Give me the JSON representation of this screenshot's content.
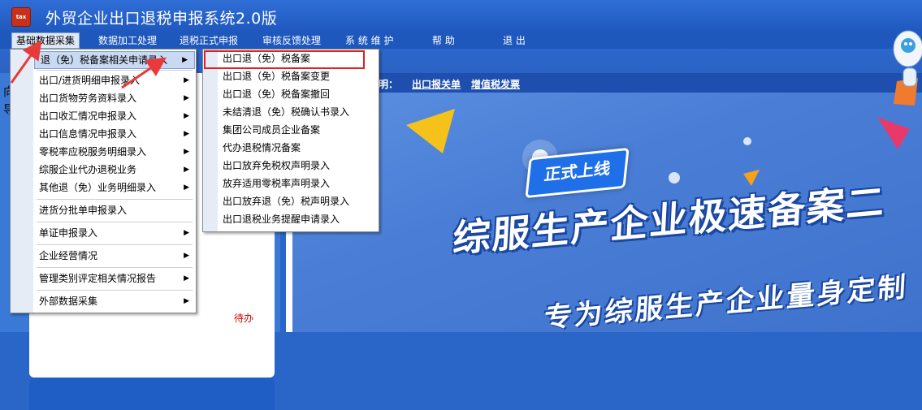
{
  "app": {
    "title": "外贸企业出口退税申报系统2.0版",
    "icon_text": "tax"
  },
  "menubar": [
    {
      "label": "基础数据采集"
    },
    {
      "label": "数据加工处理"
    },
    {
      "label": "退税正式申报"
    },
    {
      "label": "审核反馈处理"
    },
    {
      "label": "系 统 维 护"
    },
    {
      "label": "帮 助"
    },
    {
      "label": "退 出"
    }
  ],
  "left_panel": {
    "todo_label": "待办",
    "side_chars": [
      "向",
      "导"
    ]
  },
  "main": {
    "info_prefix": "说明：",
    "info_links": [
      "出口报关单",
      "增值税发票"
    ],
    "badge": "正式上线",
    "headline": "综服生产企业极速备案二",
    "subline": "专为综服生产企业量身定制"
  },
  "menu1": {
    "items": [
      {
        "label": "退（免）税备案相关申请录入",
        "submenu": true
      },
      {
        "label": "出口/进货明细申报录入",
        "submenu": true
      },
      {
        "label": "出口货物劳务资料录入",
        "submenu": true
      },
      {
        "label": "出口收汇情况申报录入",
        "submenu": true
      },
      {
        "label": "出口信息情况申报录入",
        "submenu": true
      },
      {
        "label": "零税率应税服务明细录入",
        "submenu": true
      },
      {
        "label": "综服企业代办退税业务",
        "submenu": true
      },
      {
        "label": "其他退（免）业务明细录入",
        "submenu": true
      },
      {
        "label": "进货分批单申报录入",
        "submenu": false
      },
      {
        "label": "单证申报录入",
        "submenu": true
      },
      {
        "label": "企业经营情况",
        "submenu": true
      },
      {
        "label": "管理类别评定相关情况报告",
        "submenu": true
      },
      {
        "label": "外部数据采集",
        "submenu": true
      }
    ]
  },
  "menu2": {
    "items": [
      {
        "label": "出口退（免）税备案"
      },
      {
        "label": "出口退（免）税备案变更"
      },
      {
        "label": "出口退（免）税备案撤回"
      },
      {
        "label": "未结清退（免）税确认书录入"
      },
      {
        "label": "集团公司成员企业备案"
      },
      {
        "label": "代办退税情况备案"
      },
      {
        "label": "出口放弃免税权声明录入"
      },
      {
        "label": "放弃适用零税率声明录入"
      },
      {
        "label": "出口放弃退（免）税声明录入"
      },
      {
        "label": "出口退税业务提醒申请录入"
      }
    ]
  },
  "colors": {
    "titlebar": "#1f58bd",
    "highlight_box": "#e02020",
    "arrow": "#e83a3a"
  }
}
